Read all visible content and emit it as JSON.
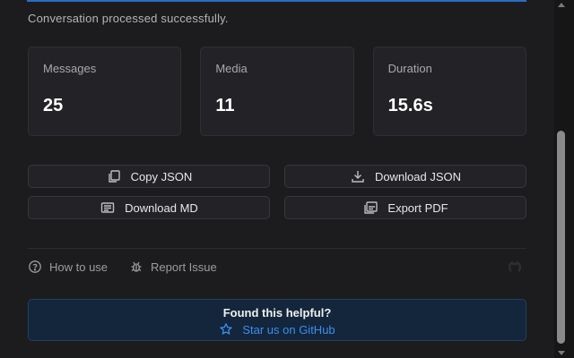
{
  "status": {
    "message": "Conversation processed successfully."
  },
  "stats": [
    {
      "label": "Messages",
      "value": "25"
    },
    {
      "label": "Media",
      "value": "11"
    },
    {
      "label": "Duration",
      "value": "15.6s"
    }
  ],
  "actions": {
    "copy_json": "Copy JSON",
    "download_json": "Download JSON",
    "download_md": "Download MD",
    "export_pdf": "Export PDF"
  },
  "footer_links": {
    "how_to_use": "How to use",
    "report_issue": "Report Issue"
  },
  "helpful": {
    "title": "Found this helpful?",
    "star_label": "Star us on GitHub"
  },
  "icons": {
    "copy": "copy-icon",
    "download": "download-icon",
    "document": "document-icon",
    "pdf": "pdf-icon",
    "help": "help-circle-icon",
    "bug": "bug-icon",
    "github": "github-icon",
    "star": "star-icon"
  },
  "colors": {
    "background": "#1c1c1f",
    "card": "#232327",
    "accent": "#3d8ef0",
    "helpful_bg": "#13263b"
  }
}
